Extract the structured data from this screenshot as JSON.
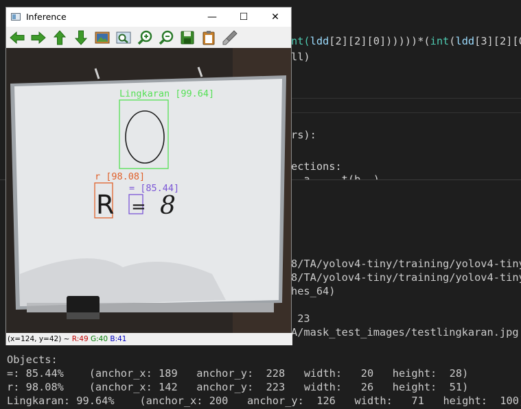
{
  "editor": {
    "line1_a": "nt(",
    "line1_b": "ldd",
    "line1_c": "[2][2][0])))))*(",
    "line1_d": "int",
    "line1_e": "(",
    "line1_f": "ldd",
    "line1_g": "[3][2][0]",
    "line2": "ll)",
    "line3": "rs):",
    "line4": "ections:",
    "line5": "  a  .  t(b  )"
  },
  "terminal": {
    "lines": [
      "8/TA/yolov4-tiny/training/yolov4-tiny",
      "8/TA/yolov4-tiny/training/yolov4-tiny",
      "hes_64)",
      "",
      " 23",
      "A/mask_test_images/testlingkaran.jpg"
    ],
    "objects_header": "Objects:",
    "objects": [
      "=: 85.44%    (anchor_x: 189   anchor_y:  228   width:   20   height:  28)",
      "r: 98.08%    (anchor_x: 142   anchor_y:  223   width:   26   height:  51)",
      "Lingkaran: 99.64%    (anchor_x: 200   anchor_y:  126   width:   71   height:  100)"
    ]
  },
  "window": {
    "title": "Inference",
    "minimize": "—",
    "maximize": "☐",
    "close": "✕",
    "toolbar_icons": [
      "pan-left-icon",
      "pan-right-icon",
      "pan-up-icon",
      "pan-down-icon",
      "image-icon",
      "zoom-fit-icon",
      "zoom-in-icon",
      "zoom-out-icon",
      "save-icon",
      "copy-icon",
      "properties-icon"
    ],
    "status": {
      "coords": "(x=124, y=42) ~ ",
      "r": "R:49",
      "g": "G:40",
      "b": "B:41"
    }
  },
  "detections": [
    {
      "label": "Lingkaran [99.64]",
      "color": "#55e055"
    },
    {
      "label": "r [98.08]",
      "color": "#e0602a"
    },
    {
      "label": "= [85.44]",
      "color": "#7a55d6"
    }
  ],
  "board": {
    "char_r": "R",
    "char_eq": "=",
    "char_8": "8"
  }
}
